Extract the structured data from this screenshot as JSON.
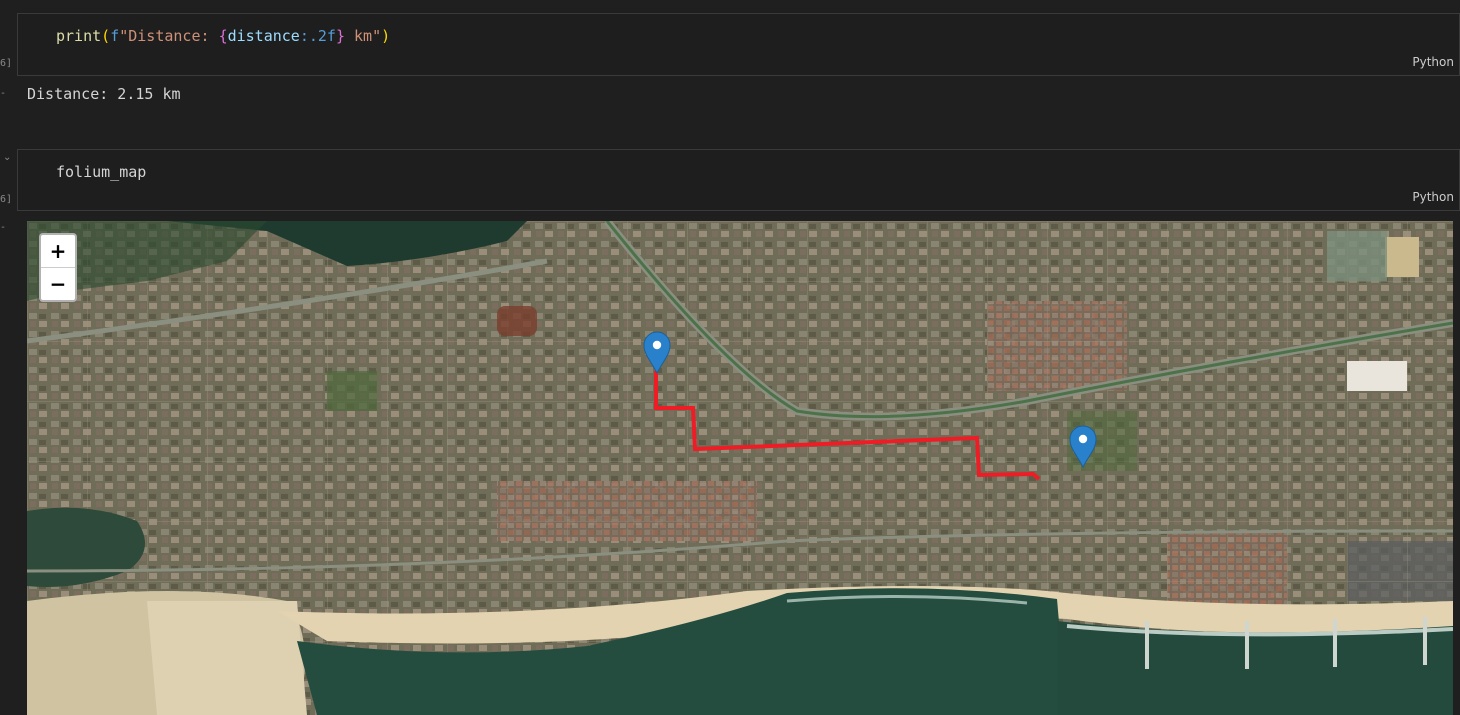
{
  "cells": [
    {
      "exec_label": "6]",
      "code": {
        "fn": "print",
        "open": "(",
        "prefix": "f",
        "str1": "\"Distance: ",
        "brace_open": "{",
        "var": "distance",
        "fmt": ":.2f",
        "brace_close": "}",
        "str2": " km\"",
        "close": ")"
      },
      "language": "Python",
      "output": "Distance: 2.15 km"
    },
    {
      "exec_label": "6]",
      "code_text": "folium_map",
      "language": "Python"
    }
  ],
  "map": {
    "zoom_in": "+",
    "zoom_out": "−",
    "layer": "satellite",
    "route_color": "#ee1c25",
    "marker_color": "#2a81cb",
    "markers": [
      "start-marker",
      "end-marker"
    ]
  },
  "icons": {
    "collapse": "chevron-down-icon"
  }
}
